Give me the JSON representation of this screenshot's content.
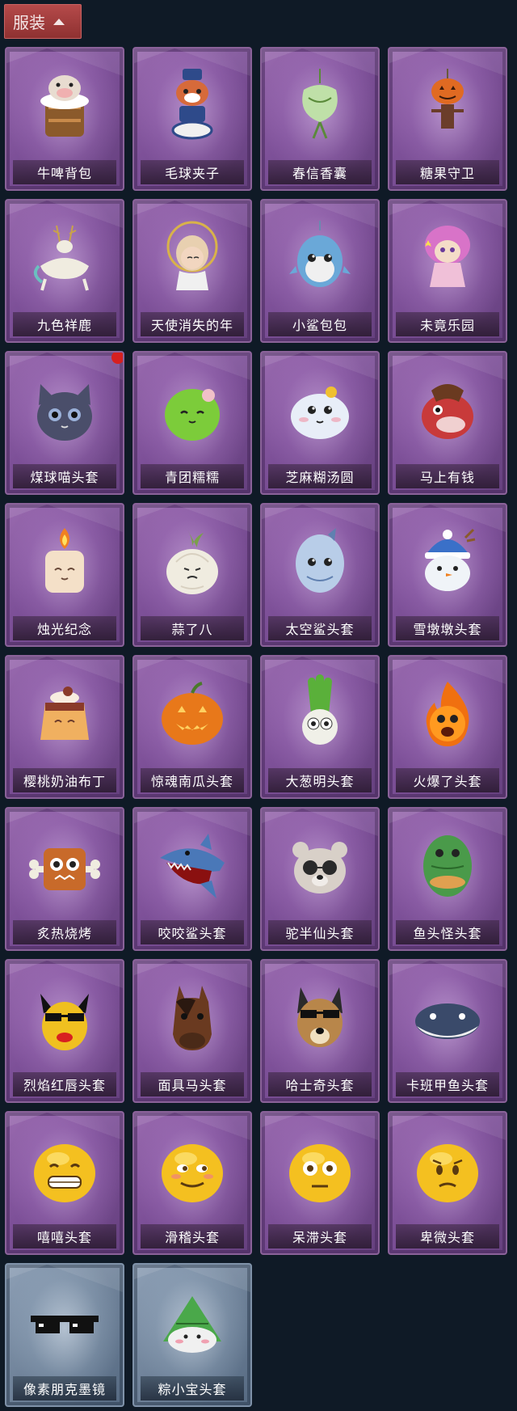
{
  "header": {
    "label": "服装"
  },
  "items": [
    {
      "label": "牛啤背包",
      "icon": "cow-beer-backpack-icon",
      "base": "#e8dcd0",
      "accent": "#8b5a2b",
      "theme": "purple",
      "badge": false
    },
    {
      "label": "毛球夹子",
      "icon": "raccoon-drummer-icon",
      "base": "#d66a3a",
      "accent": "#2e4a8a",
      "theme": "purple",
      "badge": false
    },
    {
      "label": "春信香囊",
      "icon": "green-sachet-icon",
      "base": "#bfe0a8",
      "accent": "#5a8a3a",
      "theme": "purple",
      "badge": false
    },
    {
      "label": "糖果守卫",
      "icon": "pumpkin-guard-icon",
      "base": "#e06a22",
      "accent": "#6b3d2a",
      "theme": "purple",
      "badge": false
    },
    {
      "label": "九色祥鹿",
      "icon": "nine-color-deer-icon",
      "base": "#f0ece0",
      "accent": "#c9a24a",
      "theme": "purple",
      "badge": false
    },
    {
      "label": "天使消失的年",
      "icon": "angel-girl-icon",
      "base": "#f2d6c0",
      "accent": "#d8b24a",
      "theme": "purple",
      "badge": false
    },
    {
      "label": "小鲨包包",
      "icon": "blue-shark-bag-icon",
      "base": "#6aa8d8",
      "accent": "#f0f0f0",
      "theme": "purple",
      "badge": false
    },
    {
      "label": "未竟乐园",
      "icon": "pink-hair-girl-icon",
      "base": "#d873c8",
      "accent": "#f0c0d8",
      "theme": "purple",
      "badge": false
    },
    {
      "label": "煤球喵头套",
      "icon": "black-cat-head-icon",
      "base": "#4a4e6a",
      "accent": "#9ab0d8",
      "theme": "purple",
      "badge": true
    },
    {
      "label": "青团糯糯",
      "icon": "green-rice-ball-icon",
      "base": "#7ccc3a",
      "accent": "#f0c0c8",
      "theme": "purple",
      "badge": false
    },
    {
      "label": "芝麻糊汤圆",
      "icon": "rice-dumpling-icon",
      "base": "#e8eef8",
      "accent": "#f0c030",
      "theme": "purple",
      "badge": false
    },
    {
      "label": "马上有钱",
      "icon": "red-horse-icon",
      "base": "#c83a3a",
      "accent": "#f0d0d0",
      "theme": "purple",
      "badge": false
    },
    {
      "label": "烛光纪念",
      "icon": "candle-icon",
      "base": "#f4e0c8",
      "accent": "#f08020",
      "theme": "purple",
      "badge": false
    },
    {
      "label": "蒜了八",
      "icon": "garlic-icon",
      "base": "#f0ece0",
      "accent": "#7aa04a",
      "theme": "purple",
      "badge": false
    },
    {
      "label": "太空鲨头套",
      "icon": "space-shark-head-icon",
      "base": "#b8cde8",
      "accent": "#6080b0",
      "theme": "purple",
      "badge": false
    },
    {
      "label": "雪墩墩头套",
      "icon": "snowman-head-icon",
      "base": "#f0f4f8",
      "accent": "#3a70c8",
      "theme": "purple",
      "badge": false
    },
    {
      "label": "樱桃奶油布丁",
      "icon": "pudding-icon",
      "base": "#f0b060",
      "accent": "#8a3a2a",
      "theme": "purple",
      "badge": false
    },
    {
      "label": "惊魂南瓜头套",
      "icon": "jack-o-lantern-icon",
      "base": "#e8781a",
      "accent": "#ffd060",
      "theme": "purple",
      "badge": false
    },
    {
      "label": "大葱明头套",
      "icon": "scallion-head-icon",
      "base": "#5ab03a",
      "accent": "#f0f0e8",
      "theme": "purple",
      "badge": false
    },
    {
      "label": "火爆了头套",
      "icon": "fire-head-icon",
      "base": "#f07010",
      "accent": "#ffd030",
      "theme": "purple",
      "badge": false
    },
    {
      "label": "炙热烧烤",
      "icon": "bbq-meat-icon",
      "base": "#c86a2a",
      "accent": "#f0ece0",
      "theme": "purple",
      "badge": false
    },
    {
      "label": "咬咬鲨头套",
      "icon": "biting-shark-head-icon",
      "base": "#4a78b8",
      "accent": "#f0f0f0",
      "theme": "purple",
      "badge": false
    },
    {
      "label": "驼半仙头套",
      "icon": "panda-bear-head-icon",
      "base": "#d8d0c8",
      "accent": "#2a2a2a",
      "theme": "purple",
      "badge": false
    },
    {
      "label": "鱼头怪头套",
      "icon": "fish-monster-head-icon",
      "base": "#4a9a4a",
      "accent": "#e0a050",
      "theme": "purple",
      "badge": false
    },
    {
      "label": "烈焰红唇头套",
      "icon": "yellow-mask-red-lips-icon",
      "base": "#f0c020",
      "accent": "#d82020",
      "theme": "purple",
      "badge": false
    },
    {
      "label": "面具马头套",
      "icon": "horse-mask-icon",
      "base": "#6a3a20",
      "accent": "#2a1810",
      "theme": "purple",
      "badge": false
    },
    {
      "label": "哈士奇头套",
      "icon": "husky-head-icon",
      "base": "#b8864a",
      "accent": "#2a2a2a",
      "theme": "purple",
      "badge": false
    },
    {
      "label": "卡班甲鱼头套",
      "icon": "fish-head-icon",
      "base": "#3a4a6a",
      "accent": "#f0f0f0",
      "theme": "purple",
      "badge": false
    },
    {
      "label": "嘻嘻头套",
      "icon": "grinning-emoji-icon",
      "base": "#f4c020",
      "accent": "#5a3a10",
      "theme": "purple",
      "badge": false
    },
    {
      "label": "滑稽头套",
      "icon": "smirk-emoji-icon",
      "base": "#f4c020",
      "accent": "#5a3a10",
      "theme": "purple",
      "badge": false
    },
    {
      "label": "呆滞头套",
      "icon": "dazed-emoji-icon",
      "base": "#f4c020",
      "accent": "#5a3a10",
      "theme": "purple",
      "badge": false
    },
    {
      "label": "卑微头套",
      "icon": "humble-emoji-icon",
      "base": "#f4c020",
      "accent": "#5a3a10",
      "theme": "purple",
      "badge": false
    },
    {
      "label": "像素朋克墨镜",
      "icon": "pixel-sunglasses-icon",
      "base": "#111111",
      "accent": "#ffffff",
      "theme": "blue",
      "badge": false
    },
    {
      "label": "粽小宝头套",
      "icon": "zongzi-head-icon",
      "base": "#4aa84a",
      "accent": "#f0f0f0",
      "theme": "blue",
      "badge": false
    }
  ]
}
